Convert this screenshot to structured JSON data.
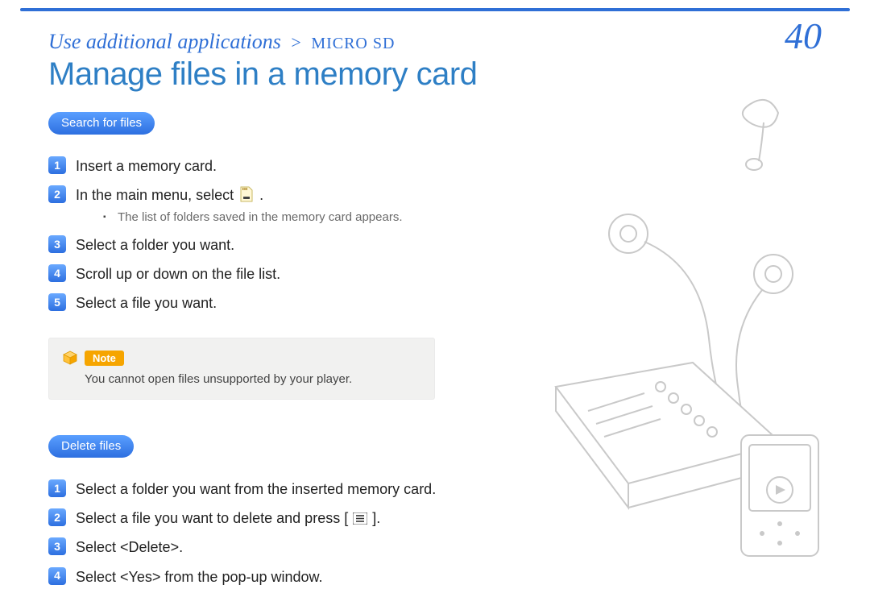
{
  "breadcrumb": {
    "parent": "Use additional applications",
    "separator": ">",
    "section": "MICRO SD"
  },
  "page_number": "40",
  "title": "Manage files in a memory card",
  "section1": {
    "heading": "Search for files",
    "steps": [
      "Insert a memory card.",
      "In the main menu, select ",
      "Select a folder you want.",
      "Scroll up or down on the file list.",
      "Select a file you want."
    ],
    "step2_suffix": ".",
    "substep": "The list of folders saved in the memory card appears."
  },
  "note": {
    "label": "Note",
    "text": "You cannot open files unsupported by your player."
  },
  "section2": {
    "heading": "Delete files",
    "steps": [
      "Select a folder you want from the inserted memory card.",
      "Select a file you want to delete and press [",
      "Select <Delete>.",
      "Select <Yes> from the pop-up window."
    ],
    "step2_suffix": "]."
  }
}
